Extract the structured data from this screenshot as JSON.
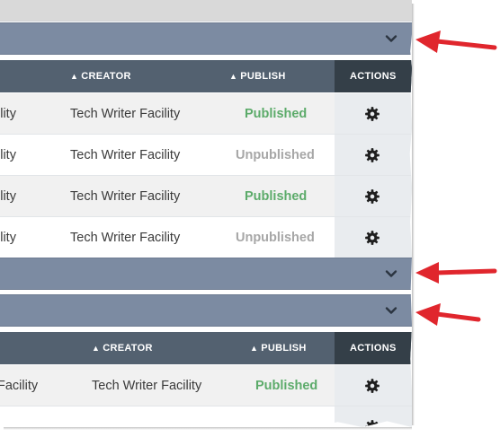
{
  "colors": {
    "group_bar": "#7c8ba2",
    "table_header": "#536170",
    "actions_header": "#343f48",
    "published": "#5cab6a",
    "unpublished": "#a7a7a7",
    "annotation_arrow": "#e0262d"
  },
  "icons": {
    "expand": "chevron-down-icon",
    "row_action": "gear-icon",
    "callout": "arrow-icon"
  },
  "table1": {
    "headers": {
      "creator": "CREATOR",
      "publish": "PUBLISH",
      "actions": "ACTIONS"
    },
    "rows": [
      {
        "title_fragment": "ility",
        "creator": "Tech Writer Facility",
        "status": "Published"
      },
      {
        "title_fragment": "ility",
        "creator": "Tech Writer Facility",
        "status": "Unpublished"
      },
      {
        "title_fragment": "ility",
        "creator": "Tech Writer Facility",
        "status": "Published"
      },
      {
        "title_fragment": "ility",
        "creator": "Tech Writer Facility",
        "status": "Unpublished"
      }
    ]
  },
  "table2": {
    "headers": {
      "creator": "CREATOR",
      "publish": "PUBLISH",
      "actions": "ACTIONS"
    },
    "rows": [
      {
        "title_fragment": "Facility",
        "creator": "Tech Writer Facility",
        "status": "Published"
      }
    ]
  }
}
